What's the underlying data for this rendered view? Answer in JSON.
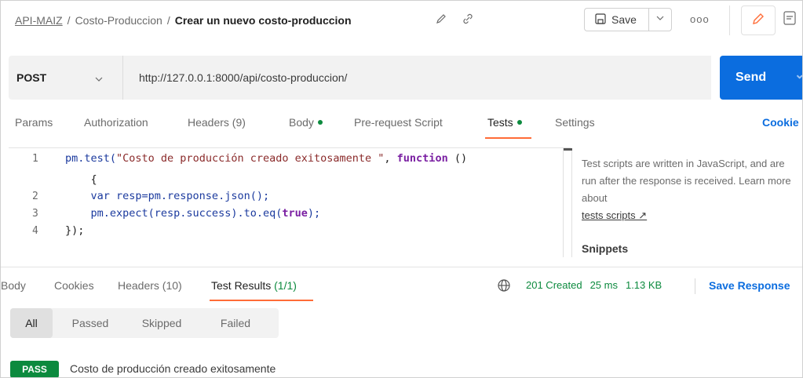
{
  "breadcrumb": {
    "collection": "API-MAIZ",
    "folder": "Costo-Produccion",
    "current": "Crear un nuevo costo-produccion",
    "separator": "/"
  },
  "toolbar": {
    "save_label": "Save",
    "more_label": "ooo"
  },
  "request": {
    "method": "POST",
    "url": "http://127.0.0.1:8000/api/costo-produccion/",
    "send_label": "Send"
  },
  "request_tabs": {
    "params": "Params",
    "authorization": "Authorization",
    "headers": "Headers (9)",
    "body": "Body",
    "prerequest": "Pre-request Script",
    "tests": "Tests",
    "settings": "Settings",
    "cookies": "Cookie"
  },
  "editor": {
    "lines": [
      {
        "num": "1",
        "parts": [
          "pm.test(",
          "\"Costo de producción creado exitosamente \"",
          ", ",
          "function",
          " ()"
        ]
      },
      {
        "num": "",
        "text": "    {"
      },
      {
        "num": "2",
        "text": "    var resp=pm.response.json();"
      },
      {
        "num": "3",
        "parts": [
          "    pm.expect(resp.success).to.eq(",
          "true",
          ");"
        ]
      },
      {
        "num": "4",
        "text": "});"
      }
    ]
  },
  "help": {
    "text": "Test scripts are written in JavaScript, and are run after the response is received. Learn more about",
    "link": "tests scripts ↗",
    "snippets": "Snippets"
  },
  "response_tabs": {
    "body": "Body",
    "cookies": "Cookies",
    "headers": "Headers (10)",
    "test_results_label": "Test Results",
    "test_results_count": "(1/1)"
  },
  "response_status": {
    "status": "201 Created",
    "time": "25 ms",
    "size": "1.13 KB",
    "save_response": "Save Response"
  },
  "filters": [
    "All",
    "Passed",
    "Skipped",
    "Failed"
  ],
  "result": {
    "badge": "PASS",
    "name": "Costo de producción creado exitosamente"
  },
  "colors": {
    "accent": "#ff6c37",
    "send": "#0b6ddf",
    "pass": "#0c8a3e"
  }
}
